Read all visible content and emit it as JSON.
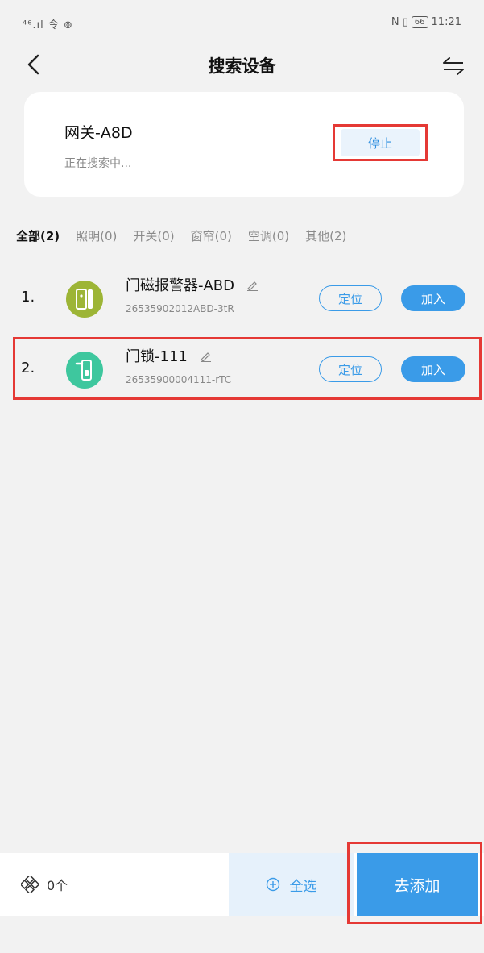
{
  "status_bar": {
    "left": "⁴⁶.ıl 令 ⊚",
    "nfc": "N",
    "vibrate": "▯",
    "battery": "66",
    "time": "11:21"
  },
  "header": {
    "title": "搜索设备",
    "back_icon": "chevron-left-icon",
    "switch_icon": "swap-icon"
  },
  "gateway": {
    "name": "网关-A8D",
    "status": "正在搜索中...",
    "stop_label": "停止"
  },
  "filters": [
    {
      "label": "全部(2)"
    },
    {
      "label": "照明(0)"
    },
    {
      "label": "开关(0)"
    },
    {
      "label": "窗帘(0)"
    },
    {
      "label": "空调(0)"
    },
    {
      "label": "其他(2)"
    }
  ],
  "devices": [
    {
      "index": "1.",
      "name": "门磁报警器-ABD",
      "id": "26535902012ABD-3tR",
      "locate_label": "定位",
      "join_label": "加入",
      "icon_color": "#9db536"
    },
    {
      "index": "2.",
      "name": "门锁-111",
      "id": "26535900004111-rTC",
      "locate_label": "定位",
      "join_label": "加入",
      "icon_color": "#3ec79e"
    }
  ],
  "bottom": {
    "count": "0个",
    "select_all": "全选",
    "add_label": "去添加"
  },
  "colors": {
    "accent": "#3a9be8",
    "highlight": "#e53935"
  }
}
